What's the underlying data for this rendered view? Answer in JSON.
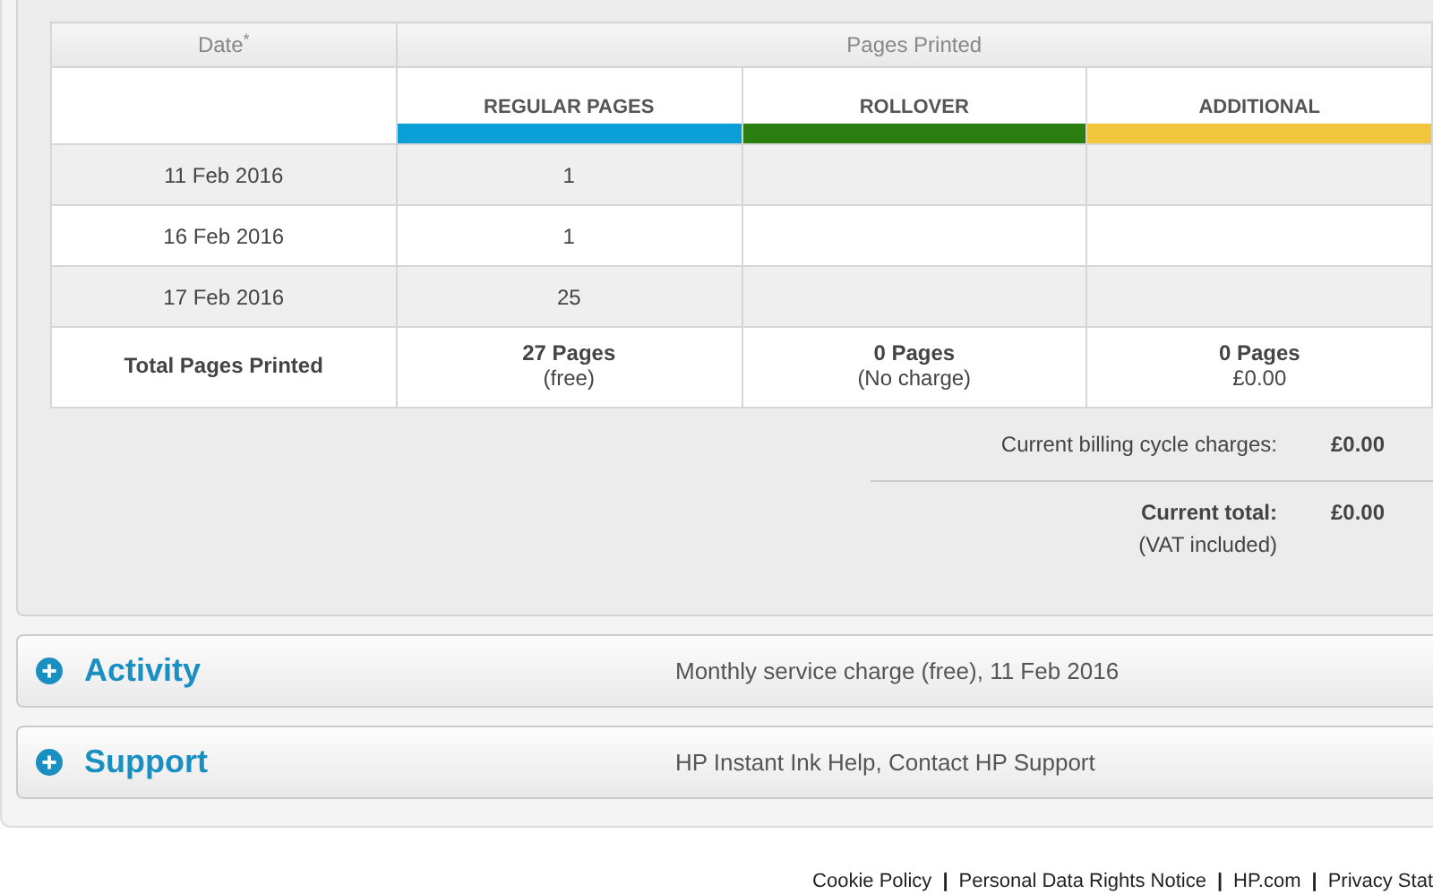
{
  "table": {
    "group_headers": [
      "Date$^{*}$",
      "Pages Printed"
    ],
    "columns": [
      {
        "label": "REGULAR PAGES",
        "color": "#0a9fd6"
      },
      {
        "label": "ROLLOVER",
        "color": "#2a7d0f"
      },
      {
        "label": "ADDITIONAL",
        "color": "#f0c63c"
      }
    ],
    "rows": [
      {
        "date": "11 Feb 2016",
        "cells": [
          "1",
          "",
          ""
        ]
      },
      {
        "date": "16 Feb 2016",
        "cells": [
          "1",
          "",
          ""
        ]
      },
      {
        "date": "17 Feb 2016",
        "cells": [
          "25",
          "",
          ""
        ]
      }
    ],
    "total": {
      "label": "Total Pages Printed",
      "cells": [
        {
          "pages": "27 Pages",
          "note": "(free)"
        },
        {
          "pages": "0 Pages",
          "note": "(No charge)"
        },
        {
          "pages": "0 Pages",
          "note": "£0.00"
        }
      ]
    }
  },
  "summary": [
    {
      "label": "Current billing cycle charges:",
      "value": "£0.00"
    },
    {
      "label": "Current total:",
      "note": "(VAT included)",
      "value": "£0.00"
    }
  ],
  "sections": [
    {
      "title": "Activity",
      "text": "Monthly service charge (free), 11 Feb 2016",
      "expanded": false
    },
    {
      "title": "Support",
      "text": "HP Instant Ink Help, Contact HP Support",
      "expanded": false
    }
  ],
  "footer": [
    {
      "kind": "link",
      "text": "Cookie Policy"
    },
    {
      "kind": "separator",
      "text": "|"
    },
    {
      "kind": "link",
      "text": "Personal Data Rights Notice"
    },
    {
      "kind": "separator",
      "text": "|"
    },
    {
      "kind": "link",
      "text": "HP.com"
    },
    {
      "kind": "separator",
      "text": "|"
    },
    {
      "kind": "link",
      "text": "Privacy Stat"
    }
  ]
}
